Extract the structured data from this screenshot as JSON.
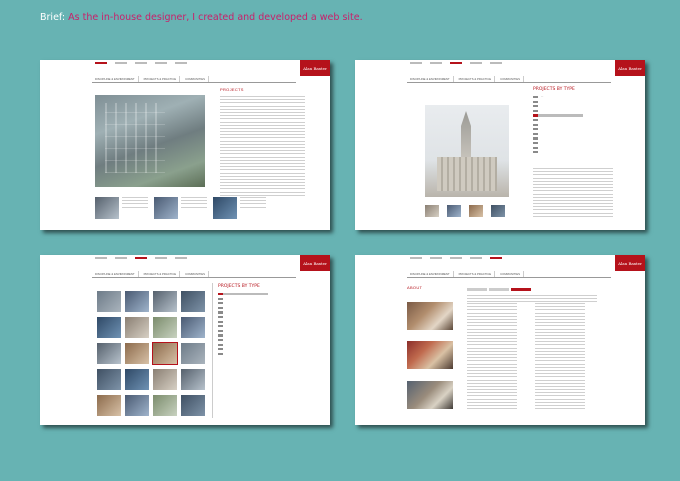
{
  "brief": {
    "label": "Brief:",
    "text": "As the in-house designer, I created and developed a web site."
  },
  "site": {
    "logo": "Alan Baxter",
    "nav": [
      "DISCIPLINE & ENVIRONMENT",
      "PROJECTS & PRACTICE",
      "COMMUNITIES"
    ]
  },
  "pages": {
    "p1": {
      "title": "PROJECTS"
    },
    "p2": {
      "title": "PROJECTS BY TYPE"
    },
    "p3": {
      "title": "PROJECTS BY TYPE"
    },
    "p4": {
      "title": "ABOUT"
    }
  },
  "colors": {
    "background": "#67b3b3",
    "accent": "#b5121b",
    "brief_text": "#c8206a"
  }
}
